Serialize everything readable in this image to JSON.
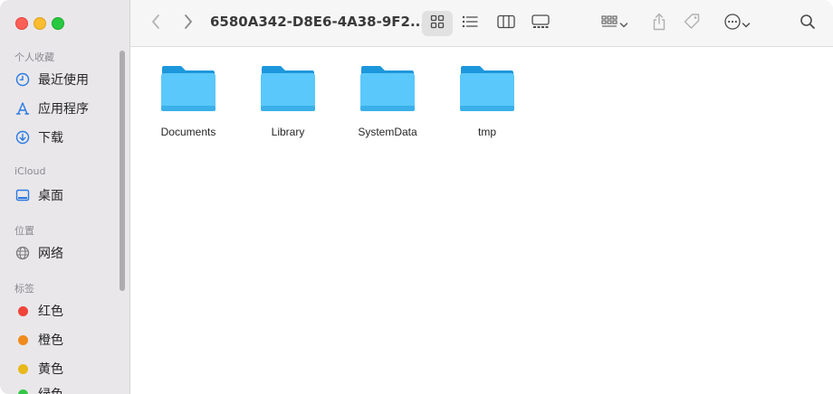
{
  "window": {
    "title": "6580A342-D8E6-4A38-9F2..."
  },
  "sidebar": {
    "sections": {
      "favorites": "个人收藏",
      "icloud": "iCloud",
      "locations": "位置",
      "tags": "标签"
    },
    "favorites": [
      {
        "label": "最近使用",
        "icon": "clock-icon"
      },
      {
        "label": "应用程序",
        "icon": "apps-icon"
      },
      {
        "label": "下载",
        "icon": "download-icon"
      }
    ],
    "icloud": [
      {
        "label": "桌面",
        "icon": "desktop-icon"
      }
    ],
    "locations": [
      {
        "label": "网络",
        "icon": "globe-icon"
      }
    ],
    "tags": [
      {
        "label": "红色",
        "color": "#f0433a"
      },
      {
        "label": "橙色",
        "color": "#f08a1c"
      },
      {
        "label": "黄色",
        "color": "#e8b81a"
      },
      {
        "label": "绿色",
        "color": "#33c748"
      }
    ]
  },
  "content": {
    "items": [
      {
        "name": "Documents",
        "icon": "folder-icon"
      },
      {
        "name": "Library",
        "icon": "folder-icon"
      },
      {
        "name": "SystemData",
        "icon": "folder-icon"
      },
      {
        "name": "tmp",
        "icon": "folder-icon"
      }
    ]
  },
  "colors": {
    "accent": "#2a7ae2",
    "folder_top": "#1f9be0",
    "folder_body": "#5ac8fa"
  }
}
